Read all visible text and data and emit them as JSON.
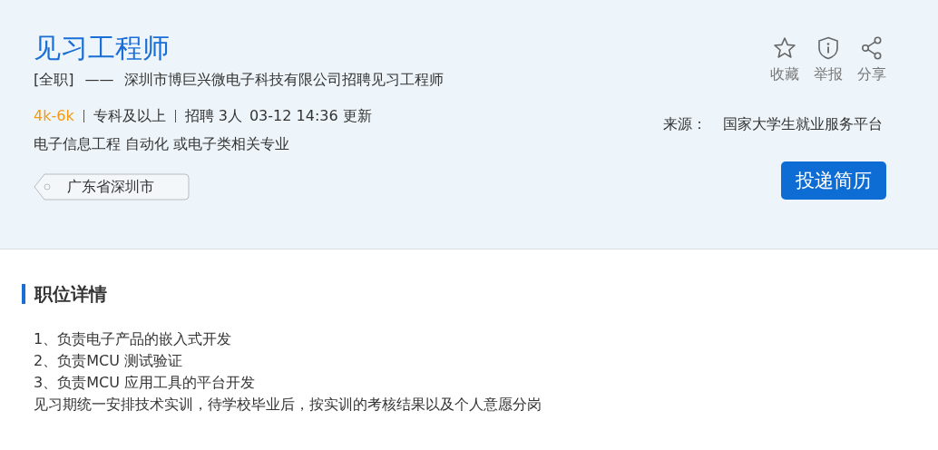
{
  "job": {
    "title": "见习工程师",
    "type": "[全职]",
    "dash": "——",
    "company_line": "深圳市博巨兴微电子科技有限公司招聘见习工程师",
    "salary": "4k-6k",
    "education": "专科及以上",
    "headcount": "招聘 3人",
    "updated": "03-12 14:36 更新",
    "majors": "电子信息工程 自动化 或电子类相关专业",
    "location": "广东省深圳市"
  },
  "actions": [
    {
      "kind": "star",
      "label": "收藏"
    },
    {
      "kind": "shield",
      "label": "举报"
    },
    {
      "kind": "share",
      "label": "分享"
    }
  ],
  "source": {
    "label": "来源：",
    "value": "国家大学生就业服务平台"
  },
  "apply_button": "投递简历",
  "details": {
    "heading": "职位详情",
    "lines": [
      "1、负责电子产品的嵌入式开发",
      "2、负责MCU 测试验证",
      "3、负责MCU 应用工具的平台开发",
      "见习期统一安排技术实训，待学校毕业后，按实训的考核结果以及个人意愿分岗"
    ]
  }
}
